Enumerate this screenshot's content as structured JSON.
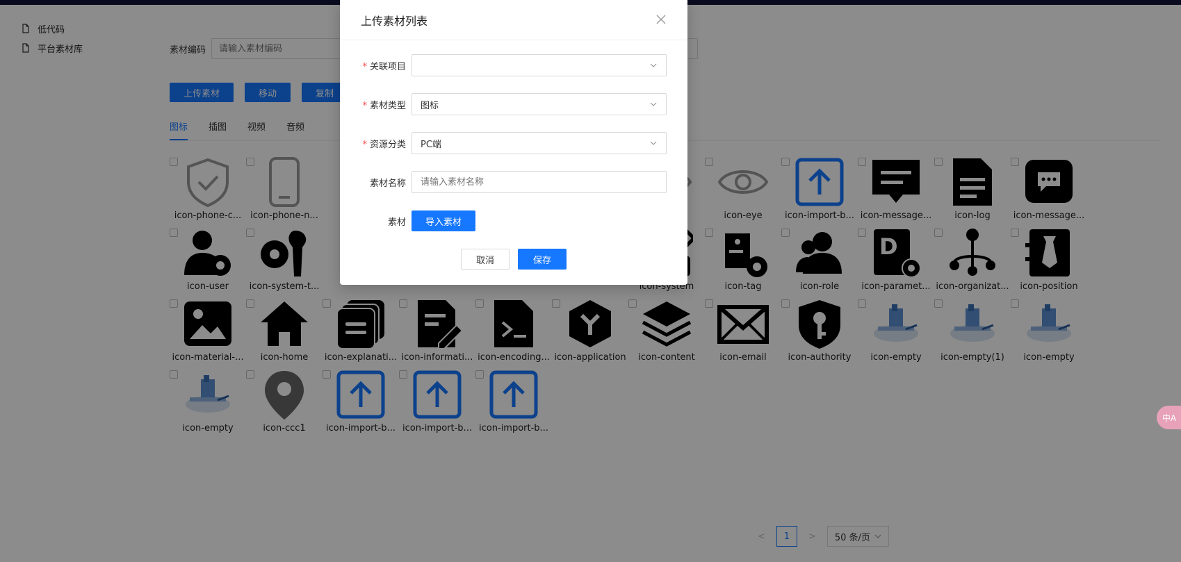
{
  "sidebar": {
    "items": [
      {
        "label": "低代码"
      },
      {
        "label": "平台素材库"
      }
    ]
  },
  "search": {
    "label": "素材编码",
    "placeholder": "请输入素材编码"
  },
  "buttons": {
    "upload": "上传素材",
    "move": "移动",
    "copy": "复制"
  },
  "tabs": [
    {
      "label": "图标"
    },
    {
      "label": "插图"
    },
    {
      "label": "视频"
    },
    {
      "label": "音频"
    }
  ],
  "icons": [
    {
      "name": "icon-phone-c...",
      "glyph": "shield-check"
    },
    {
      "name": "icon-phone-n...",
      "glyph": "phone"
    },
    {
      "name": "icon-eye",
      "glyph": "eye"
    },
    {
      "name": "icon-eye",
      "glyph": "eye"
    },
    {
      "name": "icon-import-b...",
      "glyph": "import"
    },
    {
      "name": "icon-message...",
      "glyph": "message"
    },
    {
      "name": "icon-log",
      "glyph": "log"
    },
    {
      "name": "icon-message...",
      "glyph": "chat"
    },
    {
      "name": "icon-user",
      "glyph": "user-gear"
    },
    {
      "name": "icon-system-t...",
      "glyph": "tools"
    },
    {
      "name": "icon-system",
      "glyph": "system"
    },
    {
      "name": "icon-tag",
      "glyph": "tag"
    },
    {
      "name": "icon-role",
      "glyph": "role"
    },
    {
      "name": "icon-paramet...",
      "glyph": "param"
    },
    {
      "name": "icon-organizat...",
      "glyph": "org"
    },
    {
      "name": "icon-position",
      "glyph": "position"
    },
    {
      "name": "icon-material-...",
      "glyph": "image"
    },
    {
      "name": "icon-home",
      "glyph": "home"
    },
    {
      "name": "icon-explanati...",
      "glyph": "explain"
    },
    {
      "name": "icon-informati...",
      "glyph": "info"
    },
    {
      "name": "icon-encoding...",
      "glyph": "encoding"
    },
    {
      "name": "icon-application",
      "glyph": "application"
    },
    {
      "name": "icon-content",
      "glyph": "content"
    },
    {
      "name": "icon-email",
      "glyph": "email"
    },
    {
      "name": "icon-authority",
      "glyph": "authority"
    },
    {
      "name": "icon-empty",
      "glyph": "empty"
    },
    {
      "name": "icon-empty(1)",
      "glyph": "empty"
    },
    {
      "name": "icon-empty",
      "glyph": "empty"
    },
    {
      "name": "icon-empty",
      "glyph": "empty"
    },
    {
      "name": "icon-ccc1",
      "glyph": "location"
    },
    {
      "name": "icon-import-b...",
      "glyph": "import"
    },
    {
      "name": "icon-import-b...",
      "glyph": "import"
    },
    {
      "name": "icon-import-b...",
      "glyph": "import"
    }
  ],
  "pagination": {
    "current": "1",
    "page_size": "50 条/页",
    "prev": "<",
    "next": ">"
  },
  "modal": {
    "title": "上传素材列表",
    "fields": [
      {
        "label": "关联项目",
        "required": "*",
        "value": ""
      },
      {
        "label": "素材类型",
        "required": "*",
        "value": "图标"
      },
      {
        "label": "资源分类",
        "required": "*",
        "value": "PC端"
      }
    ],
    "name_field": {
      "label": "素材名称",
      "placeholder": "请输入素材名称"
    },
    "material": {
      "label": "素材",
      "button": "导入素材"
    },
    "cancel": "取消",
    "save": "保存"
  },
  "edge_tool": {
    "label": "中A"
  },
  "colors": {
    "primary": "#1677ff",
    "overlay": "rgba(0,0,0,0.45)",
    "danger": "#ff4d4f"
  }
}
